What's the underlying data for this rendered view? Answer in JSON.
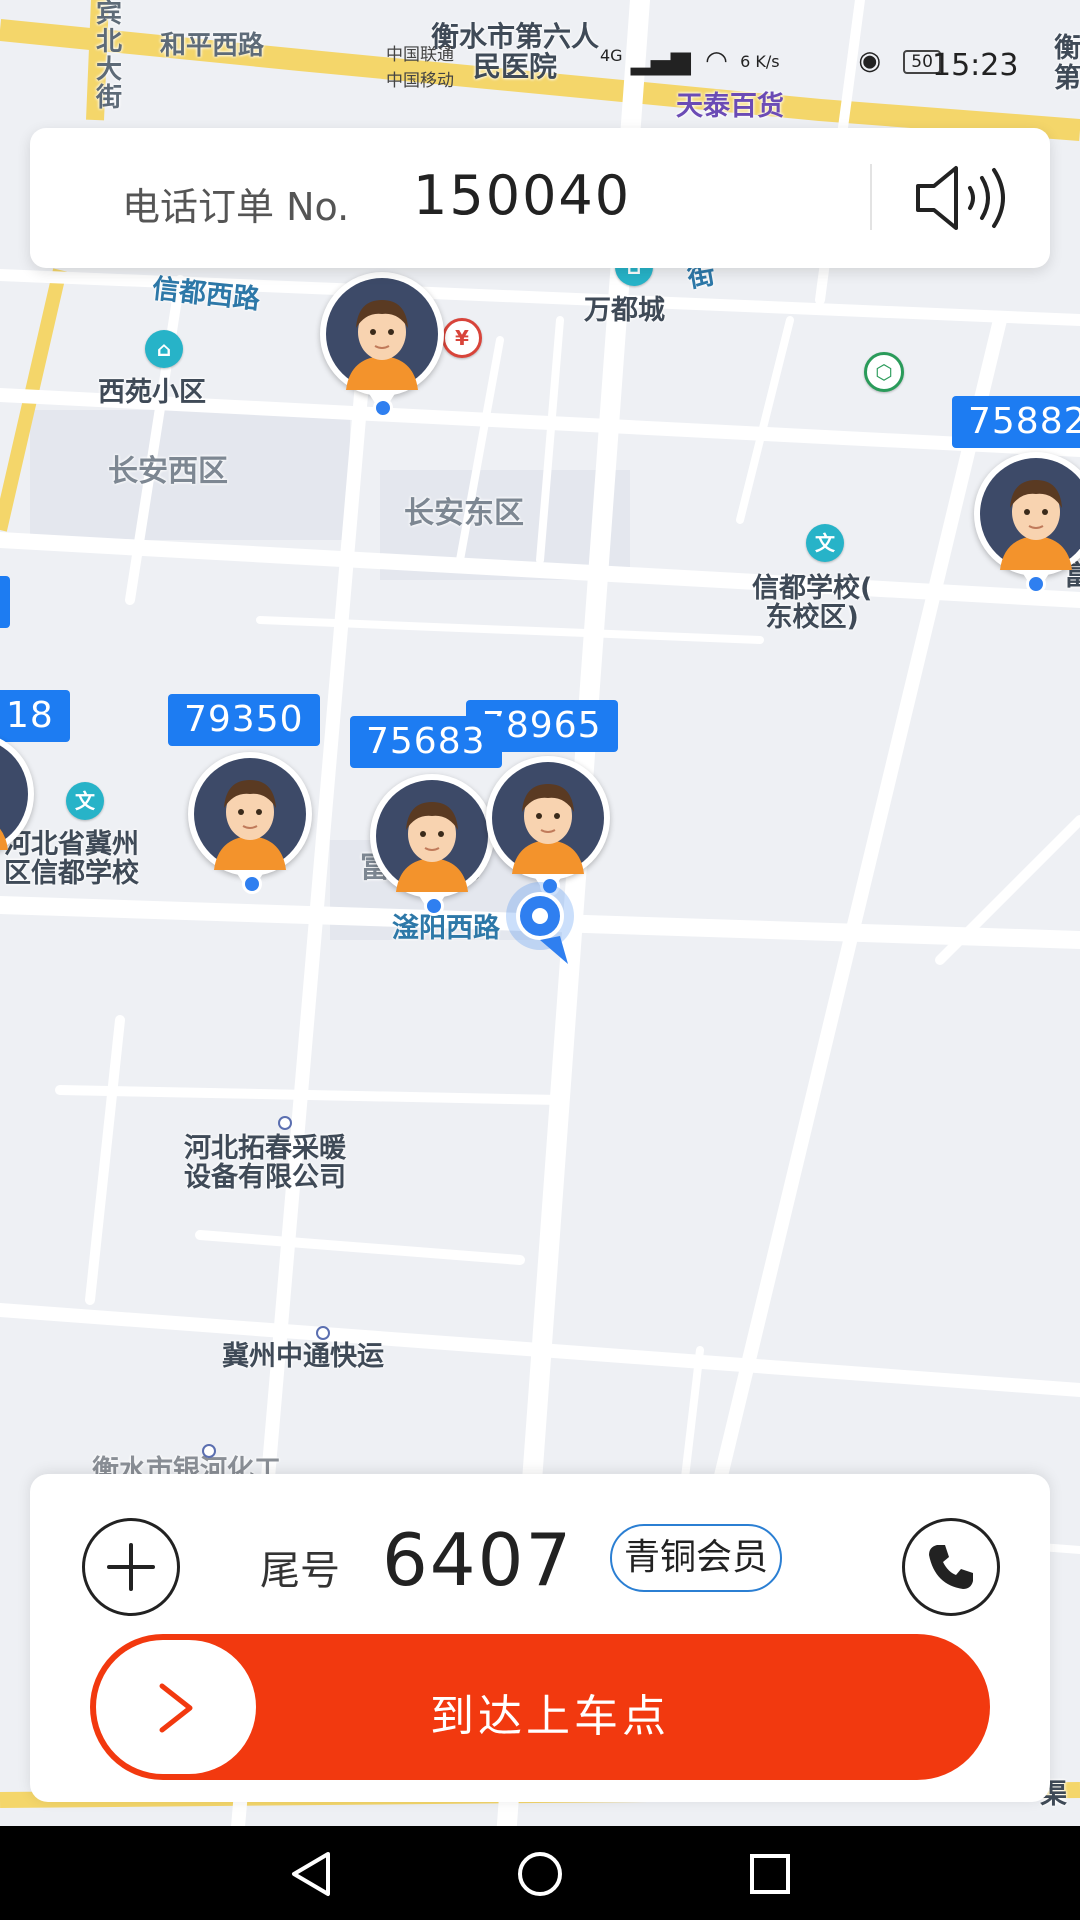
{
  "map": {
    "labels": {
      "road_heping": "和平西路",
      "road_north": "宾北大街",
      "hospital": "衡水市第六人民医院",
      "tiantai": "天泰百货",
      "wandu": "万都城",
      "xindu_road": "信都西路",
      "xiyuan": "西苑小区",
      "changan_west": "长安西区",
      "changan_east": "长安东区",
      "xindu_school": "信都学校(\n东校区)",
      "hebei_school": "河北省冀州\n区信都学校",
      "fuhao": "富港丽景",
      "fuyang_road": "滏阳西路",
      "tuochun": "河北拓春采暖\n设备有限公司",
      "zhongtong": "冀州中通快运",
      "yinhe": "衡水市银河化工",
      "right_edge": "衡\n第",
      "right_fu": "富",
      "road_s": "街",
      "right_bottom": "渠"
    },
    "drivers": [
      {
        "id": "79350"
      },
      {
        "id": "75683"
      },
      {
        "id": "78965"
      },
      {
        "id": "75882"
      },
      {
        "id": "18"
      }
    ]
  },
  "status_bar": {
    "carrier1": "中国联通",
    "carrier2": "中国移动",
    "net_type": "4G",
    "speed": "6 K/s",
    "battery": "50",
    "time": "15:23"
  },
  "order": {
    "label": "电话订单 No.",
    "number": "150040"
  },
  "passenger": {
    "tail_label": "尾号",
    "tail_number": "6407",
    "member_level": "青铜会员"
  },
  "actions": {
    "arrive_label": "到达上车点"
  },
  "colors": {
    "accent_orange": "#f2390f",
    "driver_blue": "#1d7cf2",
    "badge_border": "#2b7fd3"
  },
  "icons": {
    "speaker": "speaker-icon",
    "add": "plus-icon",
    "phone": "phone-icon",
    "slide": "chevron-right-icon",
    "back": "back-triangle-icon",
    "home": "home-circle-icon",
    "recent": "recent-square-icon"
  }
}
